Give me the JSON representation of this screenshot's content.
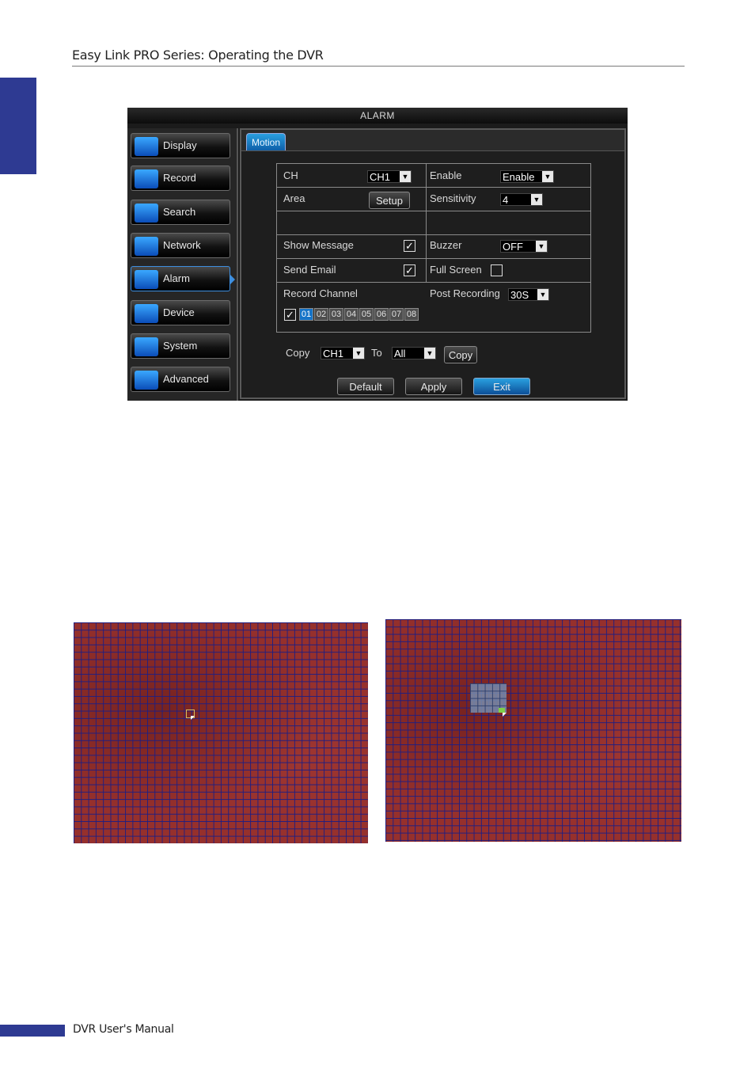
{
  "header": {
    "title": "Easy Link PRO Series: Operating the DVR"
  },
  "footer": {
    "text": "DVR User's Manual"
  },
  "dvr": {
    "title": "ALARM",
    "menu": [
      {
        "label": "Display",
        "icon": "monitor-icon"
      },
      {
        "label": "Record",
        "icon": "film-icon"
      },
      {
        "label": "Search",
        "icon": "magnifier-icon"
      },
      {
        "label": "Network",
        "icon": "globe-icon"
      },
      {
        "label": "Alarm",
        "icon": "alarm-icon",
        "active": true
      },
      {
        "label": "Device",
        "icon": "monitor-icon"
      },
      {
        "label": "System",
        "icon": "gear-icon"
      },
      {
        "label": "Advanced",
        "icon": "wrench-icon"
      }
    ],
    "tab": "Motion",
    "settings": {
      "ch_label": "CH",
      "ch_value": "CH1",
      "enable_label": "Enable",
      "enable_value": "Enable",
      "area_label": "Area",
      "setup_button": "Setup",
      "sensitivity_label": "Sensitivity",
      "sensitivity_value": "4",
      "show_message_label": "Show Message",
      "show_message_checked": true,
      "buzzer_label": "Buzzer",
      "buzzer_value": "OFF",
      "send_email_label": "Send Email",
      "send_email_checked": true,
      "full_screen_label": "Full Screen",
      "full_screen_checked": false,
      "record_channel_label": "Record Channel",
      "record_channel_all_checked": true,
      "post_recording_label": "Post Recording",
      "post_recording_value": "30S",
      "channels": [
        "01",
        "02",
        "03",
        "04",
        "05",
        "06",
        "07",
        "08"
      ],
      "selected_channel": "01"
    },
    "copy_row": {
      "copy_label": "Copy",
      "from_value": "CH1",
      "to_label": "To",
      "to_value": "All",
      "copy_button": "Copy"
    },
    "buttons": {
      "default": "Default",
      "apply": "Apply",
      "exit": "Exit"
    }
  },
  "colors": {
    "accent": "#2e3a92",
    "highlight": "#1674c8",
    "motion_grid": "#96302c"
  }
}
